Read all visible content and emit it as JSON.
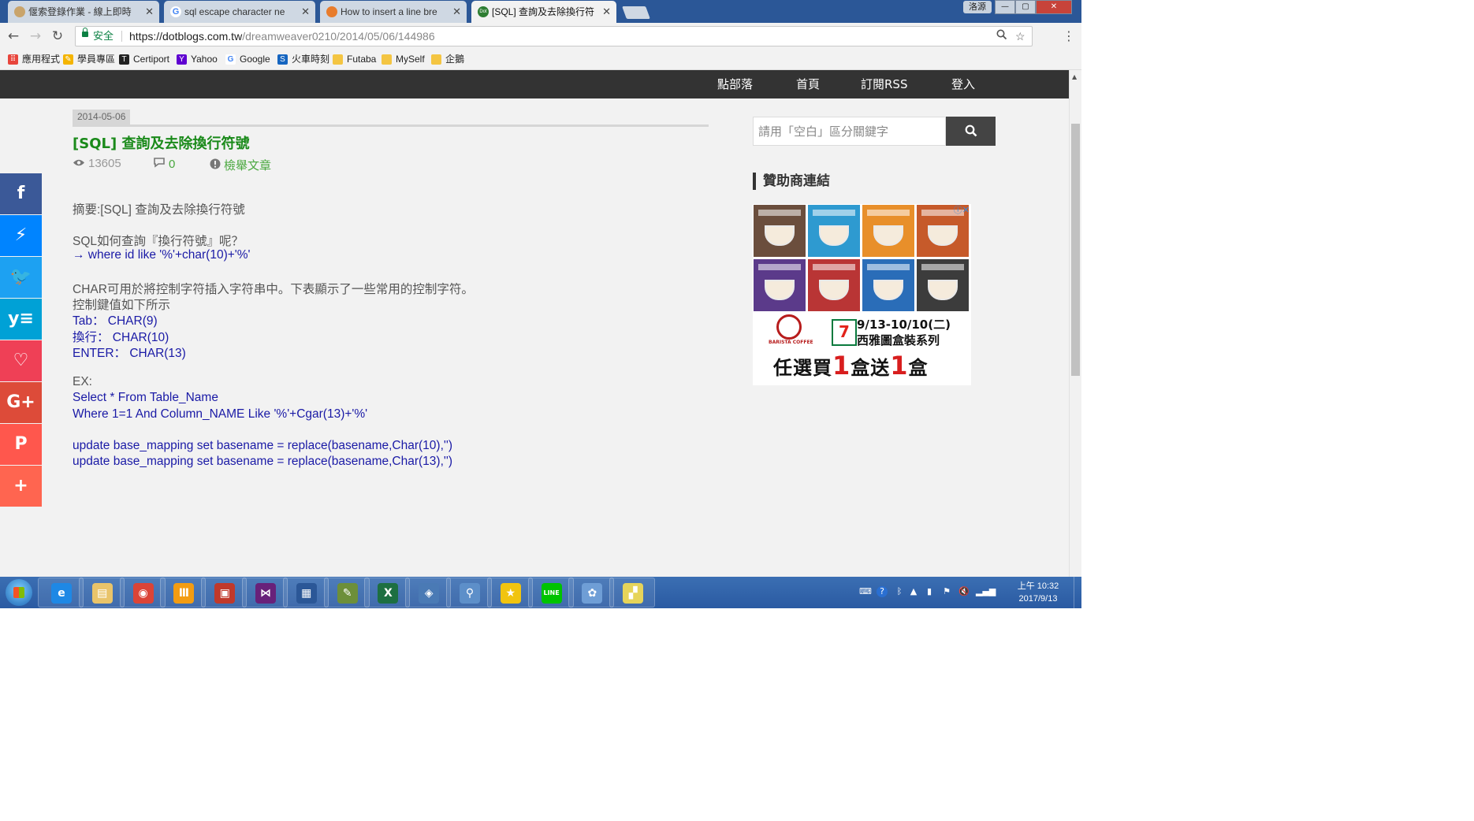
{
  "browser": {
    "tabs": [
      {
        "title": "偃索登錄作業 - 線上即時",
        "favicon_color": "#c9a46b",
        "active": false
      },
      {
        "title": "sql escape character ne",
        "favicon_color": "#4285f4",
        "favicon": "G",
        "active": false
      },
      {
        "title": "How to insert a line bre",
        "favicon_color": "#e87c2c",
        "active": false
      },
      {
        "title": "[SQL] 查詢及去除換行符",
        "favicon_color": "#2e7d32",
        "favicon": "Dot",
        "active": true
      }
    ],
    "window_user": "洛源",
    "window_buttons": {
      "minimize": "—",
      "maximize": "▢",
      "close": "✕"
    },
    "nav": {
      "back": "←",
      "forward": "→",
      "reload": "↻"
    },
    "secure_label": "安全",
    "url_host": "https://dotblogs.com.tw",
    "url_path": "/dreamweaver0210/2014/05/06/144986",
    "menu_icon": "⋮"
  },
  "bookmarks": [
    {
      "label": "應用程式",
      "icon_color": "#e8453c",
      "icon": "apps-grid-icon"
    },
    {
      "label": "學員專區",
      "icon_color": "#f4b400",
      "icon": "pen-icon"
    },
    {
      "label": "Certiport",
      "icon_color": "#222222",
      "icon": "certiport-icon"
    },
    {
      "label": "Yahoo",
      "icon_color": "#5f01d1",
      "icon": "yahoo-icon"
    },
    {
      "label": "Google",
      "icon_color": "#4285f4",
      "icon": "google-icon"
    },
    {
      "label": "火車時刻",
      "icon_color": "#1565c0",
      "icon": "train-icon"
    },
    {
      "label": "Futaba",
      "icon_color": "#f4c542",
      "icon": "folder-icon"
    },
    {
      "label": "MySelf",
      "icon_color": "#f4c542",
      "icon": "folder-icon"
    },
    {
      "label": "企鵝",
      "icon_color": "#f4c542",
      "icon": "folder-icon"
    }
  ],
  "site_nav": [
    "點部落",
    "首頁",
    "訂閱RSS",
    "登入"
  ],
  "post": {
    "date": "2014-05-06",
    "title": "[SQL] 查詢及去除換行符號",
    "views": "13605",
    "comments": "0",
    "report": "檢舉文章",
    "lines": [
      {
        "text": "摘要:[SQL] 查詢及去除換行符號",
        "style": "gray"
      },
      {
        "text": "",
        "style": "gray"
      },
      {
        "text": "SQL如何查詢『換行符號』呢？",
        "style": "gray"
      },
      {
        "text": "→ where id like '%'+char(10)+'%'",
        "style": "blue"
      },
      {
        "text": "",
        "style": "gray"
      },
      {
        "text": "CHAR可用於將控制字符插入字符串中。下表顯示了一些常用的控制字符。",
        "style": "gray"
      },
      {
        "text": "控制鍵值如下所示",
        "style": "gray"
      },
      {
        "text": "Tab：  CHAR(9)",
        "style": "blue"
      },
      {
        "text": "換行：  CHAR(10)",
        "style": "blue"
      },
      {
        "text": "ENTER：  CHAR(13)",
        "style": "blue"
      },
      {
        "text": "",
        "style": "gray"
      },
      {
        "text": "EX:",
        "style": "gray"
      },
      {
        "text": "Select * From Table_Name",
        "style": "blue"
      },
      {
        "text": "Where 1=1 And Column_NAME Like '%'+Cgar(13)+'%'",
        "style": "blue"
      },
      {
        "text": "",
        "style": "gray"
      },
      {
        "text": "update base_mapping set basename = replace(basename,Char(10),'')",
        "style": "blue"
      },
      {
        "text": "update base_mapping set basename = replace(basename,Char(13),'')",
        "style": "blue"
      }
    ]
  },
  "sidebar": {
    "search_placeholder": "請用「空白」區分關鍵字",
    "sponsor_title": "贊助商連結",
    "ad": {
      "line1": "9/13-10/10(二)",
      "line2": "西雅圖盒裝系列",
      "promo_a": "任選買",
      "promo_num1": "1",
      "promo_b": "盒送",
      "promo_num2": "1",
      "promo_c": "盒",
      "brand": "BARISTA COFFEE",
      "seven": "7",
      "close_icon": "ⓘ✕",
      "tile_colors": [
        "#6b4e3d",
        "#2e9ad0",
        "#e88f2a",
        "#c65a2a",
        "#5b3a8a",
        "#b93535",
        "#2a6db8",
        "#3c3c3c"
      ]
    }
  },
  "social": [
    {
      "name": "facebook",
      "glyph": "f",
      "color": "#3b5998"
    },
    {
      "name": "messenger",
      "glyph": "⚡",
      "color": "#0084ff"
    },
    {
      "name": "twitter",
      "glyph": "🐦",
      "color": "#1da1f2"
    },
    {
      "name": "yummly",
      "glyph": "y≡",
      "color": "#00a1d6"
    },
    {
      "name": "pocket",
      "glyph": "♡",
      "color": "#ef4056"
    },
    {
      "name": "google-plus",
      "glyph": "G+",
      "color": "#dd4b39"
    },
    {
      "name": "plurk",
      "glyph": "P",
      "color": "#ff574d"
    },
    {
      "name": "more",
      "glyph": "+",
      "color": "#ff6550"
    }
  ],
  "taskbar": {
    "apps": [
      {
        "name": "ie",
        "glyph": "e",
        "color": "#1e88e5"
      },
      {
        "name": "explorer",
        "glyph": "▤",
        "color": "#e9c46a"
      },
      {
        "name": "chrome",
        "glyph": "◉",
        "color": "#db4437"
      },
      {
        "name": "app4",
        "glyph": "Ⅲ",
        "color": "#f39c12"
      },
      {
        "name": "app5",
        "glyph": "▣",
        "color": "#c0392b"
      },
      {
        "name": "visual-studio",
        "glyph": "⋈",
        "color": "#68217a"
      },
      {
        "name": "app7",
        "glyph": "▦",
        "color": "#2b5797"
      },
      {
        "name": "app8",
        "glyph": "✎",
        "color": "#6d8f3a"
      },
      {
        "name": "excel",
        "glyph": "X",
        "color": "#1d6f42"
      },
      {
        "name": "app10",
        "glyph": "◈",
        "color": "#4a7ab5"
      },
      {
        "name": "app11",
        "glyph": "⚲",
        "color": "#5d8fc9"
      },
      {
        "name": "app12",
        "glyph": "★",
        "color": "#f1c40f"
      },
      {
        "name": "line",
        "glyph": "LINE",
        "color": "#00c300"
      },
      {
        "name": "paint",
        "glyph": "✿",
        "color": "#6f9ed6"
      },
      {
        "name": "app15",
        "glyph": "▞",
        "color": "#e6d45a"
      }
    ],
    "clock_time": "上午 10:32",
    "clock_date": "2017/9/13"
  }
}
